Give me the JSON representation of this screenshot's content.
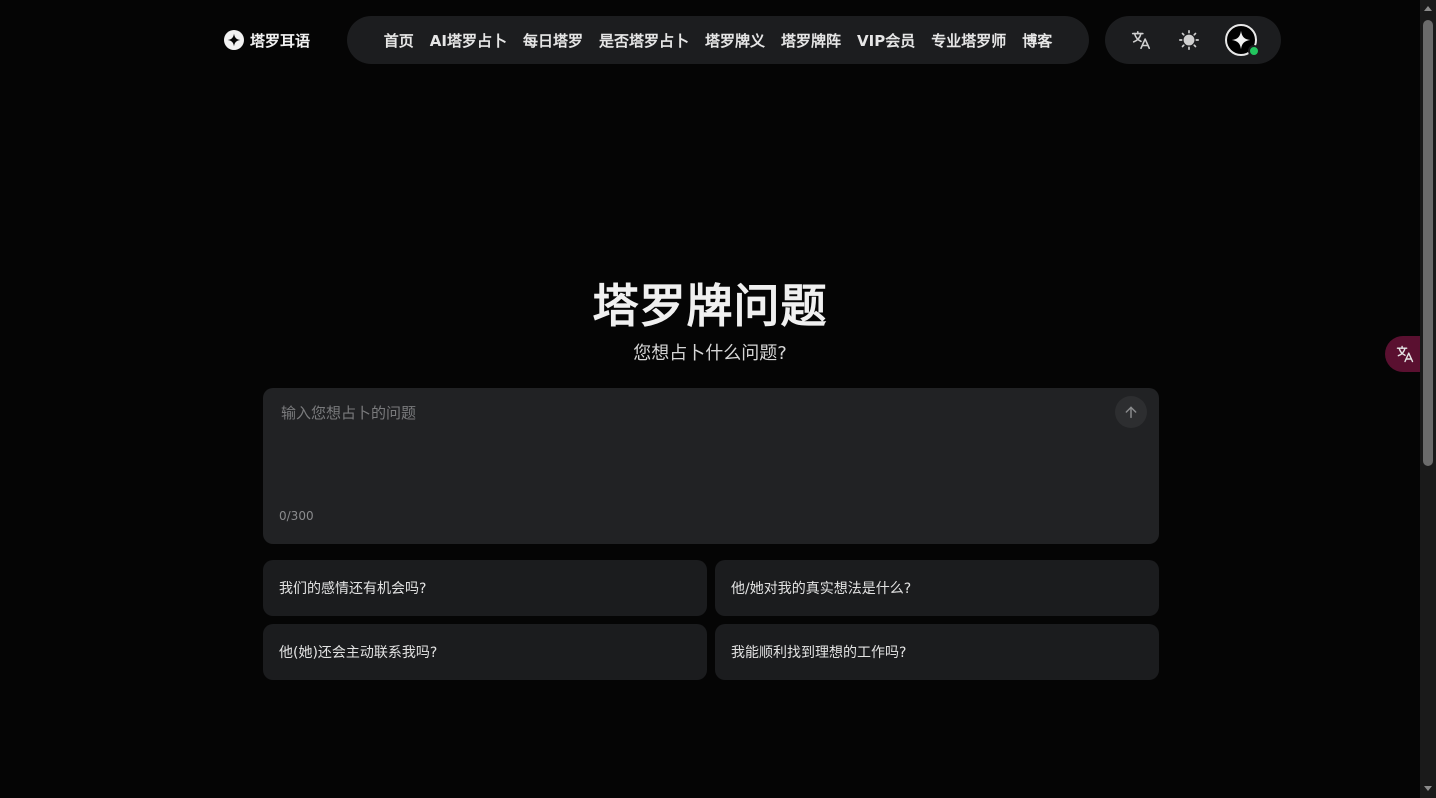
{
  "header": {
    "logo_text": "塔罗耳语",
    "nav_items": [
      {
        "label": "首页"
      },
      {
        "label": "AI塔罗占卜"
      },
      {
        "label": "每日塔罗"
      },
      {
        "label": "是否塔罗占卜"
      },
      {
        "label": "塔罗牌义"
      },
      {
        "label": "塔罗牌阵"
      },
      {
        "label": "VIP会员"
      },
      {
        "label": "专业塔罗师"
      },
      {
        "label": "博客"
      }
    ],
    "tools": {
      "language_icon": "translate-icon",
      "theme_icon": "sun-icon",
      "avatar_icon": "sparkle-icon",
      "online_status_color": "#22c55e"
    }
  },
  "hero": {
    "title": "塔罗牌问题",
    "subtitle": "您想占卜什么问题?"
  },
  "question_box": {
    "placeholder": "输入您想占卜的问题",
    "value": "",
    "counter": "0/300",
    "send_icon": "arrow-up-icon"
  },
  "suggestions": [
    {
      "label": "我们的感情还有机会吗?"
    },
    {
      "label": "他/她对我的真实想法是什么?"
    },
    {
      "label": "他(她)还会主动联系我吗?"
    },
    {
      "label": "我能顺利找到理想的工作吗?"
    }
  ],
  "floating_translate": {
    "icon": "translate-icon",
    "color": "#5a1030"
  }
}
